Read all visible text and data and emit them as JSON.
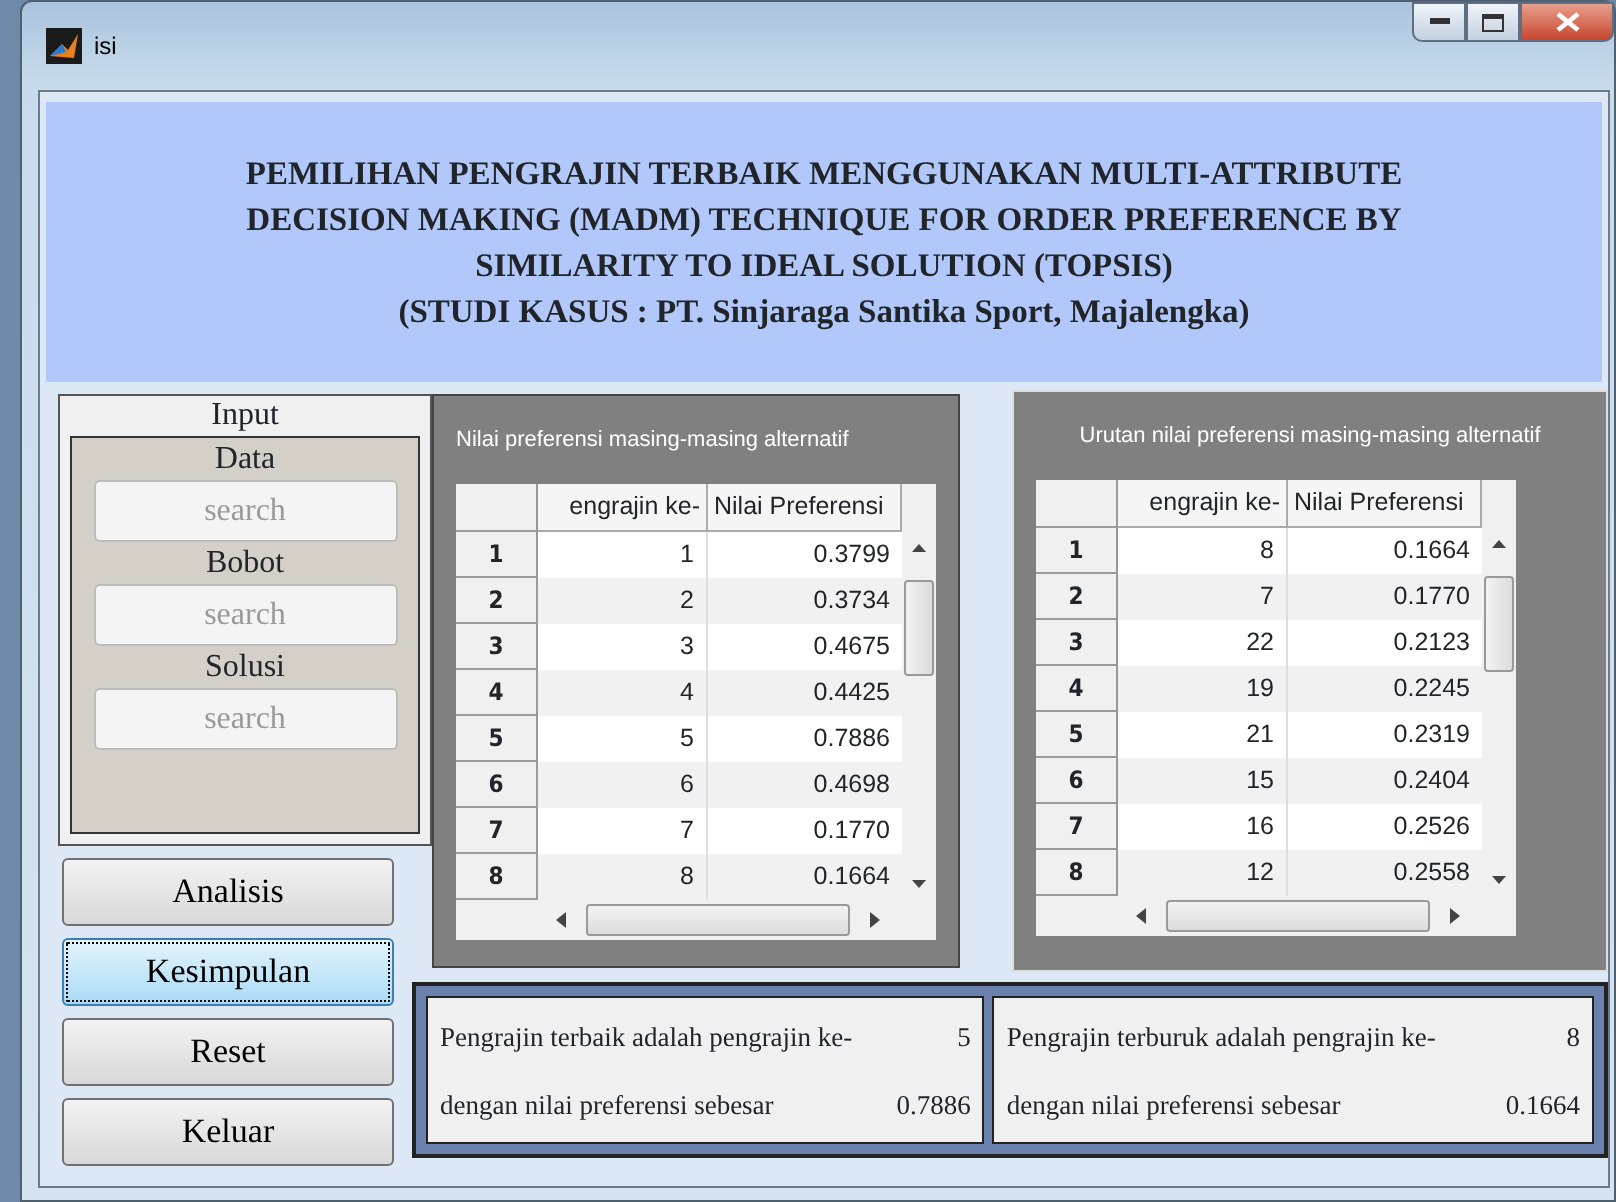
{
  "window": {
    "title": "isi"
  },
  "header": {
    "lines": [
      "PEMILIHAN PENGRAJIN TERBAIK MENGGUNAKAN MULTI-ATTRIBUTE",
      "DECISION MAKING (MADM) TECHNIQUE FOR ORDER PREFERENCE BY",
      "SIMILARITY TO IDEAL SOLUTION (TOPSIS)",
      "(STUDI KASUS : PT. Sinjaraga Santika Sport, Majalengka)"
    ]
  },
  "input_panel": {
    "title": "Input",
    "fields": [
      {
        "label": "Data",
        "button": "search",
        "disabled": true
      },
      {
        "label": "Bobot",
        "button": "search",
        "disabled": true
      },
      {
        "label": "Solusi",
        "button": "search",
        "disabled": true
      }
    ]
  },
  "buttons": [
    {
      "label": "Analisis",
      "focused": false
    },
    {
      "label": "Kesimpulan",
      "focused": true
    },
    {
      "label": "Reset",
      "focused": false
    },
    {
      "label": "Keluar",
      "focused": false
    }
  ],
  "tables": [
    {
      "title": "Nilai preferensi masing-masing alternatif",
      "columns": [
        "",
        "engrajin ke-",
        "Nilai Preferensi"
      ],
      "rows": [
        [
          "1",
          "1",
          "0.3799"
        ],
        [
          "2",
          "2",
          "0.3734"
        ],
        [
          "3",
          "3",
          "0.4675"
        ],
        [
          "4",
          "4",
          "0.4425"
        ],
        [
          "5",
          "5",
          "0.7886"
        ],
        [
          "6",
          "6",
          "0.4698"
        ],
        [
          "7",
          "7",
          "0.1770"
        ],
        [
          "8",
          "8",
          "0.1664"
        ]
      ]
    },
    {
      "title": "Urutan nilai preferensi masing-masing alternatif",
      "columns": [
        "",
        "engrajin ke-",
        "Nilai Preferensi"
      ],
      "rows": [
        [
          "1",
          "8",
          "0.1664"
        ],
        [
          "2",
          "7",
          "0.1770"
        ],
        [
          "3",
          "22",
          "0.2123"
        ],
        [
          "4",
          "19",
          "0.2245"
        ],
        [
          "5",
          "21",
          "0.2319"
        ],
        [
          "6",
          "15",
          "0.2404"
        ],
        [
          "7",
          "16",
          "0.2526"
        ],
        [
          "8",
          "12",
          "0.2558"
        ]
      ]
    }
  ],
  "results": [
    {
      "line_1": "Pengrajin terbaik adalah pengrajin ke-",
      "value_1": "5",
      "line_2": "dengan nilai preferensi sebesar",
      "value_2": "0.7886"
    },
    {
      "line_1": "Pengrajin terburuk adalah pengrajin ke-",
      "value_1": "8",
      "line_2": "dengan nilai preferensi sebesar",
      "value_2": "0.1664"
    }
  ]
}
